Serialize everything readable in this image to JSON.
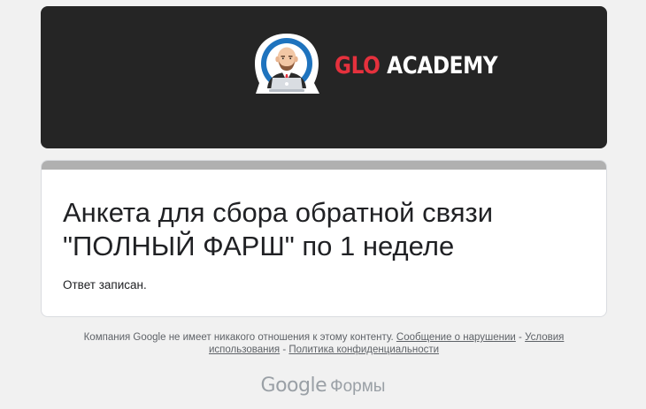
{
  "banner": {
    "brand_part1": "GLO",
    "brand_part2": "ACADEMY",
    "logo_icon": "bald-man-laptop-mascot",
    "colors": {
      "background": "#252525",
      "brand_red": "#e5313d",
      "brand_white": "#ffffff",
      "logo_ring": "#1e73be"
    }
  },
  "form": {
    "title": "Анкета для сбора обратной связи\n\"ПОЛНЫЙ ФАРШ\" по 1 неделе",
    "response_message": "Ответ записан.",
    "topbar_color": "#b0b0b0"
  },
  "footer": {
    "disclaimer": "Компания Google не имеет никакого отношения к этому контенту.",
    "report_abuse": "Сообщение о нарушении",
    "separator1": " - ",
    "terms": "Условия использования",
    "separator2": " - ",
    "privacy": "Политика конфиденциальности"
  },
  "branding": {
    "google": "Google",
    "forms": "Формы"
  }
}
